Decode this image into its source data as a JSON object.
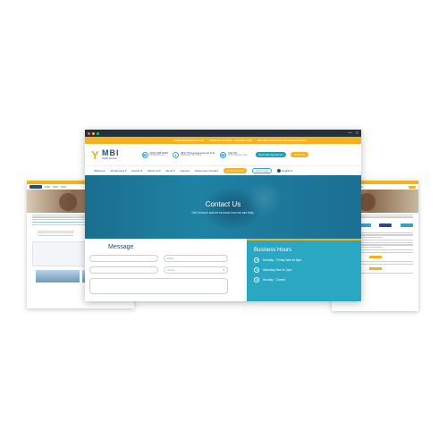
{
  "window": {
    "controls": [
      "close",
      "minimize",
      "maximize"
    ],
    "chrome_icons": [
      "minimize-icon",
      "window-icon"
    ]
  },
  "topbar": {
    "items": [
      "info@mbihealthservices.com",
      "COVID-19 Vaccination · August 5th, 2022",
      "MBI Offers COVID Drive Through Immunization"
    ]
  },
  "header": {
    "logo_name": "MBI",
    "logo_sub": "Health Services",
    "phone_main": "(202) 388-0002",
    "phone_sub": "info@mbihs.com",
    "address_main": "4817 Minnesota Avenue N.E.",
    "address_sub": "Washington DC 20019",
    "crisis_main": "Call 911",
    "crisis_sub": "Crisis Response Line",
    "book_label": "Book Intake Appointment",
    "contact_label": "Contact Us"
  },
  "nav": {
    "items": [
      "Welcome",
      "All Services ▾",
      "Events ▾",
      "About Us ▾",
      "Menu ▾",
      "Careers",
      "Resources Contact"
    ],
    "pay_label": "Pay By Insurance",
    "portal_label": "Client Portal",
    "language": "English ▾"
  },
  "hero": {
    "title": "Contact Us",
    "subtitle": "Get in touch and let us know how we can help."
  },
  "form": {
    "heading": "Message",
    "name_placeholder": "",
    "phone_placeholder": "Phone",
    "email_placeholder": "",
    "service_placeholder": "Service"
  },
  "hours": {
    "title": "Business Hours",
    "rows": [
      "Monday - Friday 9am to 5pm",
      "Saturday 9am to 2pm",
      "Sunday - Closed"
    ]
  },
  "colors": {
    "accent_orange": "#f3b21f",
    "brand_navy": "#2a4b7c",
    "teal": "#2aa8c3",
    "hero_blue": "#1f82a3"
  }
}
